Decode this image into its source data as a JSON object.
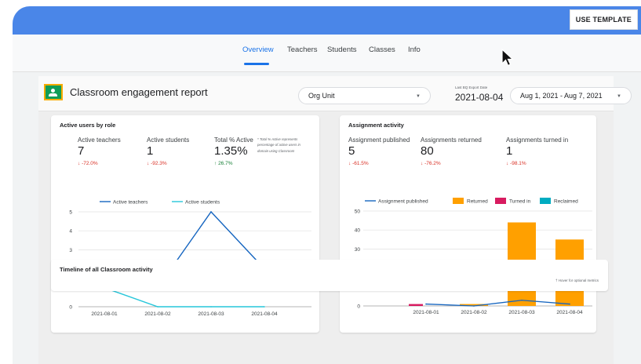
{
  "header": {
    "use_template_label": "USE TEMPLATE"
  },
  "nav": {
    "tabs": [
      "Overview",
      "Teachers",
      "Students",
      "Classes",
      "Info"
    ],
    "active": "Overview"
  },
  "report": {
    "title": "Classroom engagement report",
    "org_unit": "Org Unit",
    "export_label": "Last BQ Export Date",
    "export_date": "2021-08-04",
    "date_range": "Aug 1, 2021 - Aug 7, 2021"
  },
  "active_users": {
    "title": "Active users by role",
    "metrics": [
      {
        "label": "Active teachers",
        "value": "7",
        "delta": "-72.0%"
      },
      {
        "label": "Active students",
        "value": "1",
        "delta": "-92.3%"
      },
      {
        "label": "Total % Active",
        "value": "1.35%",
        "delta": "26.7%"
      }
    ],
    "note": "* Total % Active represents percentage of active users in domain using Classroom"
  },
  "assignments": {
    "title": "Assignment activity",
    "metrics": [
      {
        "label": "Assignment published",
        "value": "5",
        "delta": "-61.5%"
      },
      {
        "label": "Assignments returned",
        "value": "80",
        "delta": "-76.2%"
      },
      {
        "label": "Assignments turned in",
        "value": "1",
        "delta": "-98.1%"
      }
    ]
  },
  "timeline": {
    "title": "Timeline of all Classroom activity",
    "hover_note": "† Hover for optional metrics"
  },
  "colors": {
    "banner": "#4a86e8",
    "accent": "#1a73e8",
    "negative": "#d93025",
    "positive": "#188038",
    "teachers": "#1565c0",
    "students": "#26c6da",
    "returned": "#ffa000",
    "turned_in": "#d81b60",
    "reclaimed": "#00acc1",
    "logo_bg": "#f9ab00",
    "logo_fg": "#0f9d58"
  },
  "icons": {
    "cursor": "arrow-cursor-icon",
    "caret": "caret-down-icon",
    "logo": "classroom-logo-icon",
    "delta_down": "arrow-down-icon",
    "delta_up": "arrow-up-icon"
  },
  "chart_data": [
    {
      "type": "line",
      "x": [
        "2021-08-01",
        "2021-08-02",
        "2021-08-03",
        "2021-08-04"
      ],
      "series": [
        {
          "name": "Active teachers",
          "values": [
            2,
            1,
            5,
            2
          ]
        },
        {
          "name": "Active students",
          "values": [
            1,
            0,
            0,
            0
          ]
        }
      ],
      "yticks": [
        0,
        1,
        2,
        3,
        4,
        5
      ],
      "ylim": [
        0,
        5
      ],
      "grid": true,
      "legend": "top"
    },
    {
      "type": "bar",
      "categories": [
        "2021-08-01",
        "2021-08-02",
        "2021-08-03",
        "2021-08-04"
      ],
      "series": [
        {
          "name": "Assignment published",
          "kind": "line",
          "values": [
            1,
            0,
            3,
            1
          ]
        },
        {
          "name": "Returned",
          "kind": "bar",
          "values": [
            0,
            1,
            44,
            35
          ]
        },
        {
          "name": "Turned in",
          "kind": "bar",
          "values": [
            1,
            0,
            0,
            0
          ]
        },
        {
          "name": "Reclaimed",
          "kind": "bar",
          "values": [
            0,
            0,
            0,
            0
          ]
        }
      ],
      "yticks": [
        0,
        10,
        20,
        30,
        40,
        50
      ],
      "ylim": [
        0,
        50
      ],
      "grid": true,
      "legend": "top"
    }
  ]
}
